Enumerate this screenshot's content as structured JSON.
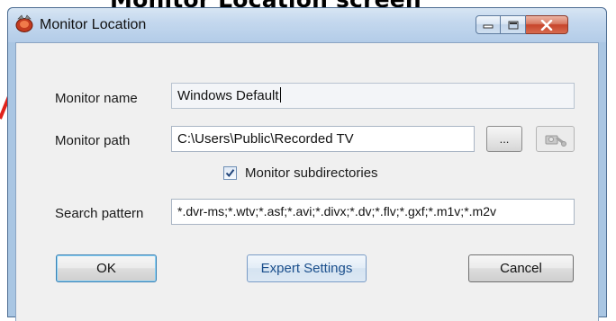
{
  "caption": "Monitor Location screen",
  "window": {
    "title": "Monitor Location"
  },
  "form": {
    "monitor_name": {
      "label": "Monitor name",
      "value": "Windows Default"
    },
    "monitor_path": {
      "label": "Monitor path",
      "value": "C:\\Users\\Public\\Recorded TV",
      "browse_label": "..."
    },
    "subdirectories": {
      "label": "Monitor subdirectories",
      "checked": true
    },
    "search_pattern": {
      "label": "Search pattern",
      "value": "*.dvr-ms;*.wtv;*.asf;*.avi;*.divx;*.dv;*.flv;*.gxf;*.m1v;*.m2v"
    }
  },
  "buttons": {
    "ok": "OK",
    "expert": "Expert Settings",
    "cancel": "Cancel"
  },
  "icons": {
    "app": "record-icon",
    "minimize": "minimize-icon",
    "maximize": "maximize-icon",
    "close": "close-icon",
    "network": "network-drive-icon",
    "check": "check-icon"
  },
  "colors": {
    "frame": "#a9c6e3",
    "client": "#f0f0f0",
    "close_button": "#c7442b",
    "annotation": "#e0221b"
  }
}
